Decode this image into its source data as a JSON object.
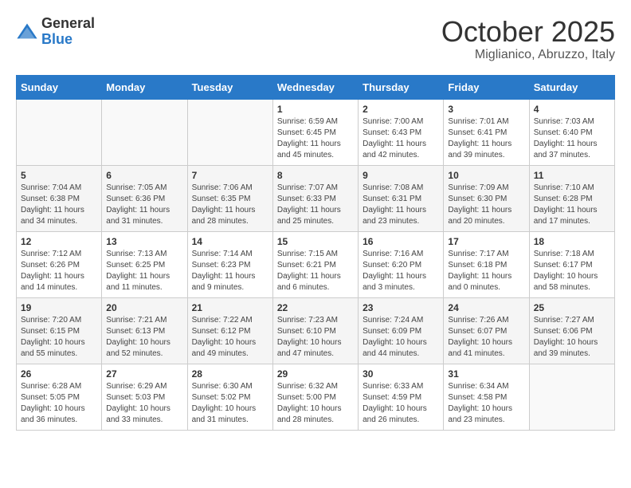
{
  "logo": {
    "general": "General",
    "blue": "Blue"
  },
  "header": {
    "month": "October 2025",
    "location": "Miglianico, Abruzzo, Italy"
  },
  "days_of_week": [
    "Sunday",
    "Monday",
    "Tuesday",
    "Wednesday",
    "Thursday",
    "Friday",
    "Saturday"
  ],
  "weeks": [
    [
      {
        "day": "",
        "text": ""
      },
      {
        "day": "",
        "text": ""
      },
      {
        "day": "",
        "text": ""
      },
      {
        "day": "1",
        "text": "Sunrise: 6:59 AM\nSunset: 6:45 PM\nDaylight: 11 hours and 45 minutes."
      },
      {
        "day": "2",
        "text": "Sunrise: 7:00 AM\nSunset: 6:43 PM\nDaylight: 11 hours and 42 minutes."
      },
      {
        "day": "3",
        "text": "Sunrise: 7:01 AM\nSunset: 6:41 PM\nDaylight: 11 hours and 39 minutes."
      },
      {
        "day": "4",
        "text": "Sunrise: 7:03 AM\nSunset: 6:40 PM\nDaylight: 11 hours and 37 minutes."
      }
    ],
    [
      {
        "day": "5",
        "text": "Sunrise: 7:04 AM\nSunset: 6:38 PM\nDaylight: 11 hours and 34 minutes."
      },
      {
        "day": "6",
        "text": "Sunrise: 7:05 AM\nSunset: 6:36 PM\nDaylight: 11 hours and 31 minutes."
      },
      {
        "day": "7",
        "text": "Sunrise: 7:06 AM\nSunset: 6:35 PM\nDaylight: 11 hours and 28 minutes."
      },
      {
        "day": "8",
        "text": "Sunrise: 7:07 AM\nSunset: 6:33 PM\nDaylight: 11 hours and 25 minutes."
      },
      {
        "day": "9",
        "text": "Sunrise: 7:08 AM\nSunset: 6:31 PM\nDaylight: 11 hours and 23 minutes."
      },
      {
        "day": "10",
        "text": "Sunrise: 7:09 AM\nSunset: 6:30 PM\nDaylight: 11 hours and 20 minutes."
      },
      {
        "day": "11",
        "text": "Sunrise: 7:10 AM\nSunset: 6:28 PM\nDaylight: 11 hours and 17 minutes."
      }
    ],
    [
      {
        "day": "12",
        "text": "Sunrise: 7:12 AM\nSunset: 6:26 PM\nDaylight: 11 hours and 14 minutes."
      },
      {
        "day": "13",
        "text": "Sunrise: 7:13 AM\nSunset: 6:25 PM\nDaylight: 11 hours and 11 minutes."
      },
      {
        "day": "14",
        "text": "Sunrise: 7:14 AM\nSunset: 6:23 PM\nDaylight: 11 hours and 9 minutes."
      },
      {
        "day": "15",
        "text": "Sunrise: 7:15 AM\nSunset: 6:21 PM\nDaylight: 11 hours and 6 minutes."
      },
      {
        "day": "16",
        "text": "Sunrise: 7:16 AM\nSunset: 6:20 PM\nDaylight: 11 hours and 3 minutes."
      },
      {
        "day": "17",
        "text": "Sunrise: 7:17 AM\nSunset: 6:18 PM\nDaylight: 11 hours and 0 minutes."
      },
      {
        "day": "18",
        "text": "Sunrise: 7:18 AM\nSunset: 6:17 PM\nDaylight: 10 hours and 58 minutes."
      }
    ],
    [
      {
        "day": "19",
        "text": "Sunrise: 7:20 AM\nSunset: 6:15 PM\nDaylight: 10 hours and 55 minutes."
      },
      {
        "day": "20",
        "text": "Sunrise: 7:21 AM\nSunset: 6:13 PM\nDaylight: 10 hours and 52 minutes."
      },
      {
        "day": "21",
        "text": "Sunrise: 7:22 AM\nSunset: 6:12 PM\nDaylight: 10 hours and 49 minutes."
      },
      {
        "day": "22",
        "text": "Sunrise: 7:23 AM\nSunset: 6:10 PM\nDaylight: 10 hours and 47 minutes."
      },
      {
        "day": "23",
        "text": "Sunrise: 7:24 AM\nSunset: 6:09 PM\nDaylight: 10 hours and 44 minutes."
      },
      {
        "day": "24",
        "text": "Sunrise: 7:26 AM\nSunset: 6:07 PM\nDaylight: 10 hours and 41 minutes."
      },
      {
        "day": "25",
        "text": "Sunrise: 7:27 AM\nSunset: 6:06 PM\nDaylight: 10 hours and 39 minutes."
      }
    ],
    [
      {
        "day": "26",
        "text": "Sunrise: 6:28 AM\nSunset: 5:05 PM\nDaylight: 10 hours and 36 minutes."
      },
      {
        "day": "27",
        "text": "Sunrise: 6:29 AM\nSunset: 5:03 PM\nDaylight: 10 hours and 33 minutes."
      },
      {
        "day": "28",
        "text": "Sunrise: 6:30 AM\nSunset: 5:02 PM\nDaylight: 10 hours and 31 minutes."
      },
      {
        "day": "29",
        "text": "Sunrise: 6:32 AM\nSunset: 5:00 PM\nDaylight: 10 hours and 28 minutes."
      },
      {
        "day": "30",
        "text": "Sunrise: 6:33 AM\nSunset: 4:59 PM\nDaylight: 10 hours and 26 minutes."
      },
      {
        "day": "31",
        "text": "Sunrise: 6:34 AM\nSunset: 4:58 PM\nDaylight: 10 hours and 23 minutes."
      },
      {
        "day": "",
        "text": ""
      }
    ]
  ]
}
